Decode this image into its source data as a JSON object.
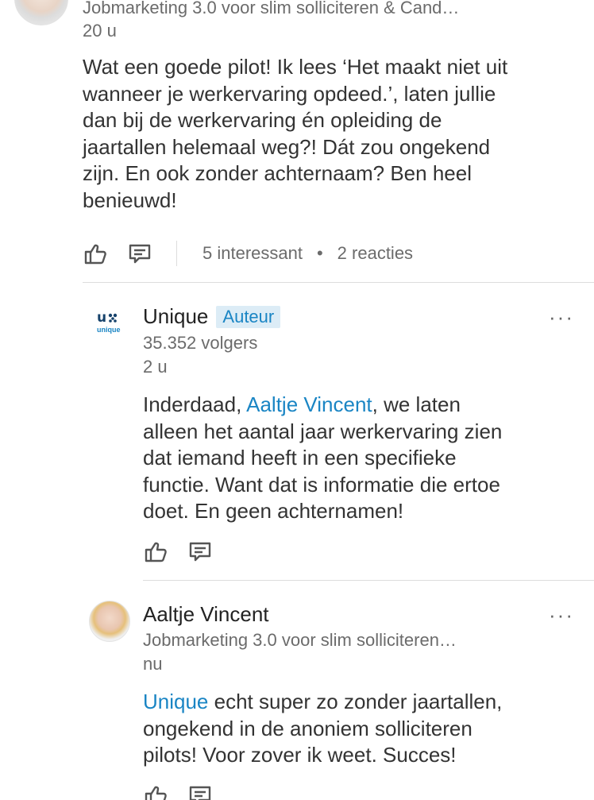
{
  "comment1": {
    "subtitle": "Jobmarketing 3.0 voor slim solliciteren & Cand…",
    "time": "20 u",
    "text_lines": [
      "Wat een goede pilot! Ik lees ‘Het maakt niet uit",
      "wanneer je werkervaring opdeed.’, laten jullie",
      "dan bij de werkervaring én opleiding de",
      "jaartallen helemaal weg?! Dát zou ongekend",
      "zijn. En ook zonder achternaam? Ben heel",
      "benieuwd!"
    ],
    "interesting": "5 interessant",
    "dot": "•",
    "replies": "2 reacties"
  },
  "reply1": {
    "logo_letter": "u",
    "logo_word": "unique",
    "name": "Unique",
    "badge": "Auteur",
    "followers": "35.352 volgers",
    "time": "2 u",
    "text_line1_pre": "Inderdaad, ",
    "text_line1_link": "Aaltje Vincent",
    "text_line1_post": ", we laten",
    "text_lines": [
      "alleen het aantal jaar werkervaring zien",
      "dat iemand heeft in een specifieke",
      "functie. Want dat is informatie die ertoe",
      "doet. En geen achternamen!"
    ],
    "more": "···"
  },
  "reply2": {
    "name": "Aaltje Vincent",
    "subtitle": "Jobmarketing 3.0 voor slim solliciteren…",
    "time": "nu",
    "text_line1_link": "Unique",
    "text_line1_post": " echt super zo zonder jaartallen,",
    "text_lines": [
      "ongekend in de anoniem solliciteren",
      "pilots! Voor zover ik weet. Succes!"
    ],
    "more": "···"
  },
  "icons": {
    "like": "thumbs-up-icon",
    "comment": "comment-icon"
  },
  "colors": {
    "link": "#1a85c4",
    "badge_bg": "#dcecf6",
    "text": "#333333",
    "muted": "#6b6b6b"
  }
}
